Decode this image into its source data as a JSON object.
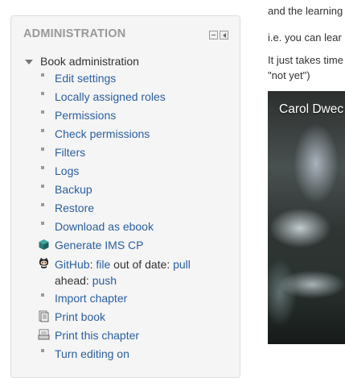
{
  "admin": {
    "title": "ADMINISTRATION",
    "root_label": "Book administration",
    "items": [
      {
        "label": "Edit settings",
        "icon": "bullet"
      },
      {
        "label": "Locally assigned roles",
        "icon": "bullet"
      },
      {
        "label": "Permissions",
        "icon": "bullet"
      },
      {
        "label": "Check permissions",
        "icon": "bullet"
      },
      {
        "label": "Filters",
        "icon": "bullet"
      },
      {
        "label": "Logs",
        "icon": "bullet"
      },
      {
        "label": "Backup",
        "icon": "bullet"
      },
      {
        "label": "Restore",
        "icon": "bullet"
      },
      {
        "label": "Download as ebook",
        "icon": "bullet"
      },
      {
        "label": "Generate IMS CP",
        "icon": "package-icon"
      }
    ],
    "github": {
      "github_link": "GitHub",
      "colon": ":",
      "file_link": "file",
      "out_of_date": "out of date:",
      "pull_link": "pull",
      "ahead": "ahead:",
      "push_link": "push",
      "icon": "github-octocat-icon"
    },
    "items_after": [
      {
        "label": "Import chapter",
        "icon": "bullet"
      },
      {
        "label": "Print book",
        "icon": "print-book-icon"
      },
      {
        "label": "Print this chapter",
        "icon": "print-chapter-icon"
      },
      {
        "label": "Turn editing on",
        "icon": "bullet"
      }
    ]
  },
  "content": {
    "line1": "and the learning",
    "line2": "i.e. you can lear",
    "line3": "It just takes time",
    "line4": "\"not yet\")",
    "video_caption": "Carol Dwec"
  },
  "colors": {
    "link": "#2a5f9e",
    "block_bg": "#f5f5f5",
    "title": "#999999"
  }
}
